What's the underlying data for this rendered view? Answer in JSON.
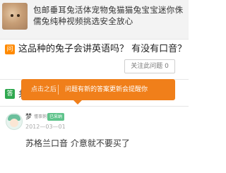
{
  "banner": {
    "text": "包邮垂耳兔活体宠物兔猫猫兔宝宝迷你侏儒兔纯种视频挑选安全放心"
  },
  "question": {
    "badge": "问",
    "text": "这品种的兔子会讲英语吗？  有没有口音？",
    "follow_label": "关注此问题 0"
  },
  "best_answer": {
    "badge": "答",
    "text": "共"
  },
  "toast": {
    "left_text": "点击之后",
    "right_text": "问题有新的答案更新会提醒你"
  },
  "answer": {
    "username": "梦",
    "level": "懂事鹅鹅",
    "adopt_badge": "已采纳",
    "date": "2012—03—01",
    "text": "苏格兰口音  介意就不要买了"
  },
  "colors": {
    "question_badge": "#ff8a00",
    "answer_badge": "#2fa84f",
    "toast_bg": "#f07f1a",
    "adopt_badge": "#5fc38b"
  }
}
